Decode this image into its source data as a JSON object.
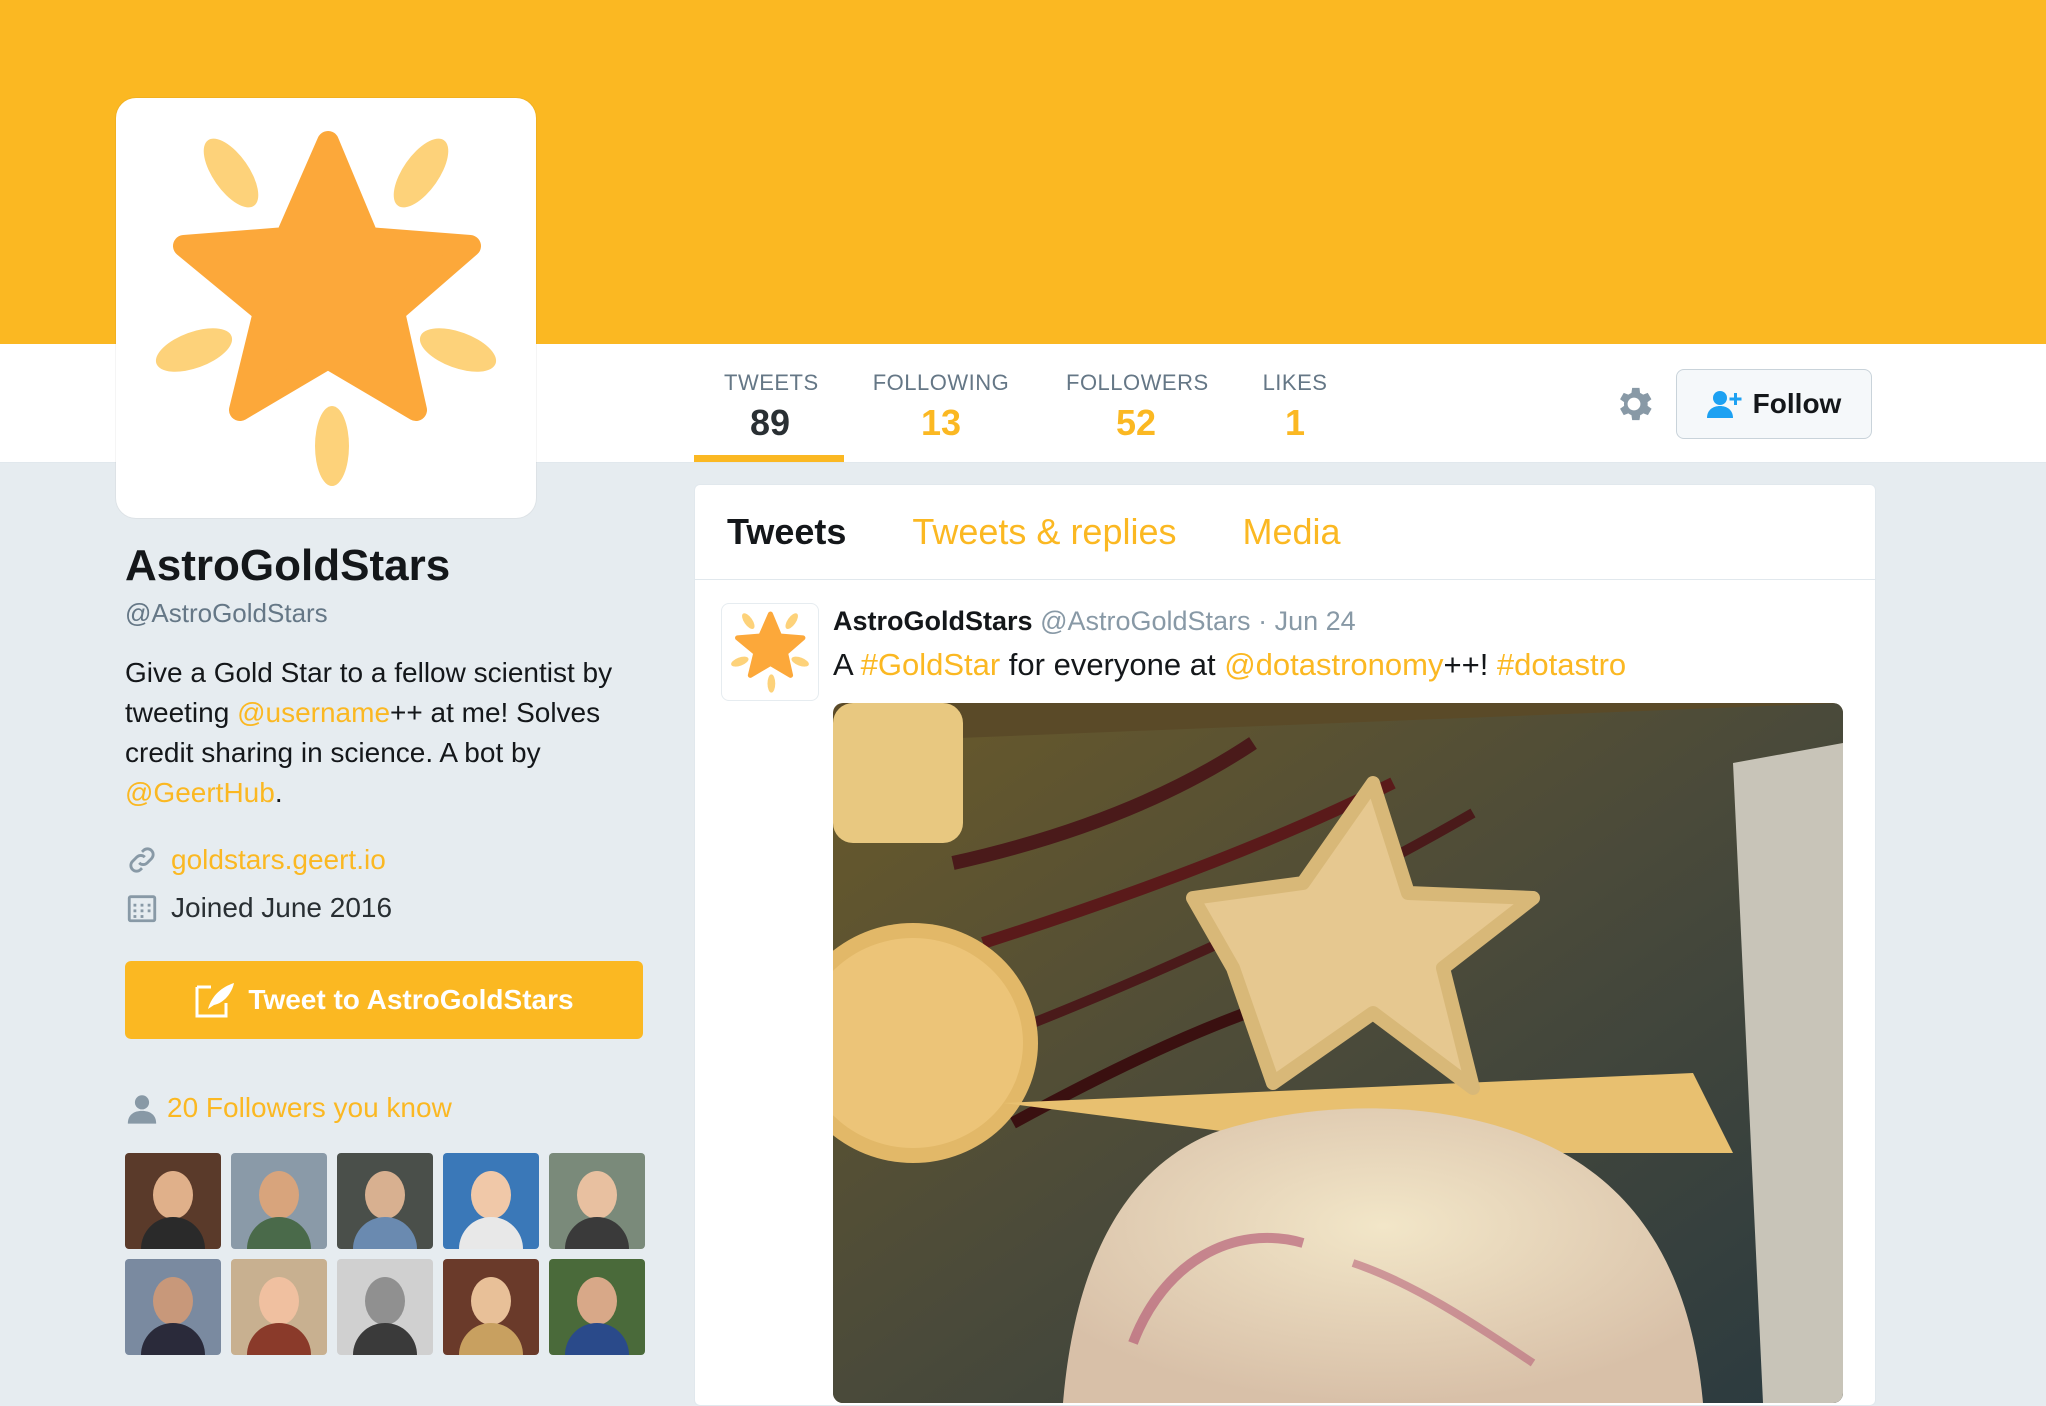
{
  "profile": {
    "name": "AstroGoldStars",
    "handle": "@AstroGoldStars",
    "bio": {
      "part1": "Give a Gold Star to a fellow scientist by tweeting ",
      "mention1": "@username",
      "part2": "++ at me! Solves credit sharing in science. A bot by ",
      "mention2": "@GeertHub",
      "part3": "."
    },
    "website": "goldstars.geert.io",
    "joined": "Joined June 2016",
    "tweet_to_label": "Tweet to AstroGoldStars",
    "followers_you_know": "20 Followers you know",
    "accent_color": "#fbb822"
  },
  "stats": [
    {
      "label": "TWEETS",
      "value": "89"
    },
    {
      "label": "FOLLOWING",
      "value": "13"
    },
    {
      "label": "FOLLOWERS",
      "value": "52"
    },
    {
      "label": "LIKES",
      "value": "1"
    }
  ],
  "actions": {
    "follow_label": "Follow",
    "settings_icon": "gear-icon"
  },
  "tabs": [
    "Tweets",
    "Tweets & replies",
    "Media"
  ],
  "tweet": {
    "name": "AstroGoldStars",
    "handle": "@AstroGoldStars",
    "separator": "·",
    "date": "Jun 24",
    "text": {
      "t1": "A ",
      "tag1": "#GoldStar",
      "t2": " for everyone at ",
      "mention": "@dotastronomy",
      "t3": "++! ",
      "tag2": "#dotastro"
    }
  }
}
